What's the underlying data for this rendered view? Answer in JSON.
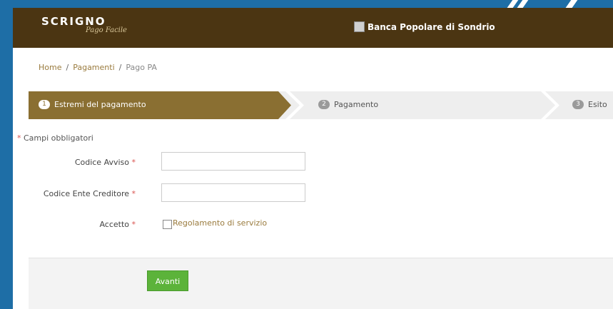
{
  "header": {
    "logo_main": "SCRIGNO",
    "logo_sub": "Pago Facile",
    "bank_name": "Banca Popolare di Sondrio"
  },
  "breadcrumb": {
    "items": [
      "Home",
      "Pagamenti",
      "Pago PA"
    ],
    "separator": "/"
  },
  "steps": [
    {
      "num": "1",
      "label": "Estremi del pagamento"
    },
    {
      "num": "2",
      "label": "Pagamento"
    },
    {
      "num": "3",
      "label": "Esito"
    }
  ],
  "form": {
    "required_note": "Campi obbligatori",
    "star": "*",
    "fields": [
      {
        "label": "Codice Avviso",
        "value": ""
      },
      {
        "label": "Codice Ente Creditore",
        "value": ""
      }
    ],
    "accept_label": "Accetto",
    "accept_link": "Regolamento di servizio"
  },
  "actions": {
    "next": "Avanti"
  },
  "colors": {
    "header": "#4b3512",
    "active_step": "#8a6f32",
    "button": "#5cb33a",
    "background": "#1e6ea6"
  }
}
